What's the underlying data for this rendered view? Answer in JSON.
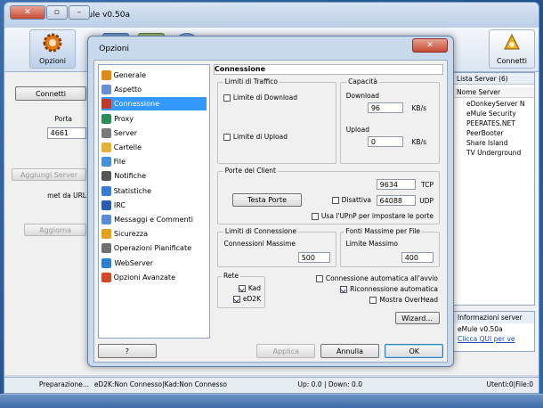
{
  "window": {
    "title": "eMule v0.50a",
    "caption_buttons": {
      "minimize": "–",
      "maximize": "▫",
      "close": "✕"
    }
  },
  "toolbar": {
    "buttons": [
      {
        "label": "Connetti",
        "icon": "connect-icon"
      },
      {
        "label": "Opzioni",
        "icon": "options-gear-icon"
      }
    ]
  },
  "server_pane": {
    "tab_label": "Lista Server (6)",
    "column_header": "Nome Server",
    "rows": [
      "eDonkeyServer N",
      "eMule Security",
      "PEERATES.NET",
      "PeerBooter",
      "Share Island",
      "TV Underground"
    ]
  },
  "side_pane": {
    "connect_button": "Connetti",
    "port_label": "Porta",
    "port_value": "4661",
    "add_server_button": "Aggiungi Server",
    "met_label": "met da URL",
    "update_button": "Aggiorna"
  },
  "info_pane": {
    "title": "Informazioni server",
    "line1": "eMule v0.50a",
    "line2": "Clicca QUI per ve"
  },
  "status_bar": {
    "users": "Utenti:0|File:0",
    "transfer": "Up: 0.0 | Down: 0.0",
    "network": "eD2K:Non Connesso|Kad:Non Connesso",
    "status": "Preparazione..."
  },
  "dialog": {
    "title": "Opzioni",
    "close_label": "✕",
    "tree": [
      {
        "label": "Generale",
        "icon": "general-icon",
        "color": "#e08a1e"
      },
      {
        "label": "Aspetto",
        "icon": "appearance-icon",
        "color": "#6a8fd0"
      },
      {
        "label": "Connessione",
        "icon": "connection-icon",
        "color": "#c0392b",
        "selected": true
      },
      {
        "label": "Proxy",
        "icon": "proxy-icon",
        "color": "#2e8b57"
      },
      {
        "label": "Server",
        "icon": "server-icon",
        "color": "#7a7a7a"
      },
      {
        "label": "Cartelle",
        "icon": "folders-icon",
        "color": "#e3b23c"
      },
      {
        "label": "File",
        "icon": "file-icon",
        "color": "#4a90d9"
      },
      {
        "label": "Notifiche",
        "icon": "notifications-icon",
        "color": "#555555"
      },
      {
        "label": "Statistiche",
        "icon": "statistics-icon",
        "color": "#3a7bd5"
      },
      {
        "label": "IRC",
        "icon": "irc-icon",
        "color": "#2a5db0"
      },
      {
        "label": "Messaggi e Commenti",
        "icon": "messages-icon",
        "color": "#5a8bd6"
      },
      {
        "label": "Sicurezza",
        "icon": "security-icon",
        "color": "#e0a020"
      },
      {
        "label": "Operazioni Pianificate",
        "icon": "scheduler-icon",
        "color": "#6f6f6f"
      },
      {
        "label": "WebServer",
        "icon": "webserver-icon",
        "color": "#2f7fd0"
      },
      {
        "label": "Opzioni Avanzate",
        "icon": "advanced-icon",
        "color": "#d04a2a"
      }
    ],
    "section_header": "Connessione",
    "capacity": {
      "group_label": "Capacità",
      "download_label": "Download",
      "download_value": "96",
      "upload_label": "Upload",
      "upload_value": "0",
      "unit": "KB/s"
    },
    "limits": {
      "group_label": "Limiti di Traffico",
      "download_limit": "Limite di Download",
      "upload_limit": "Limite di Upload"
    },
    "client_ports": {
      "group_label": "Porte del Client",
      "tcp_label": "TCP",
      "tcp_value": "9634",
      "udp_label": "UDP",
      "udp_value": "64088",
      "disable_label": "Disattiva",
      "test_button": "Testa Porte",
      "upnp_label": "Usa l'UPnP per impostare le porte"
    },
    "max_sources": {
      "group_label": "Fonti Massime per File",
      "limit_label": "Limite Massimo",
      "limit_value": "400"
    },
    "conn_limits": {
      "group_label": "Limiti di Connessione",
      "max_label": "Connessioni Massime",
      "max_value": "500"
    },
    "network": {
      "group_label": "Rete",
      "kad": "Kad",
      "ed2k": "eD2K"
    },
    "options": {
      "auto_connect": "Connessione automatica all'avvio",
      "reconnect": "Riconnessione automatica",
      "show_overhead": "Mostra OverHead"
    },
    "wizard_button": "Wizard...",
    "buttons": {
      "ok": "OK",
      "cancel": "Annulla",
      "apply": "Applica",
      "help": "?"
    }
  }
}
